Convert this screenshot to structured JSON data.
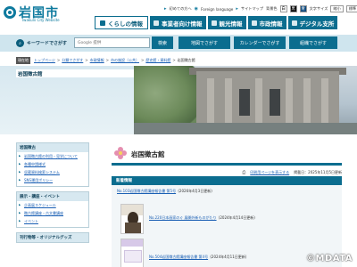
{
  "header": {
    "logo_text": "岩国市",
    "logo_sub": "Iwakuni City Website",
    "utility": {
      "first_visit": "初めての方へ",
      "foreign_language": "Foreign language",
      "sitemap": "サイトマップ",
      "bg_color_label": "背景色",
      "bg_white": "白",
      "bg_black": "黒",
      "bg_blue": "青",
      "font_size_label": "文字サイズ",
      "size_small": "縮小",
      "size_default": "標準",
      "size_large": "拡大"
    },
    "gnav": [
      {
        "label": "くらしの情報"
      },
      {
        "label": "事業者向け情報"
      },
      {
        "label": "観光情報"
      },
      {
        "label": "市政情報"
      },
      {
        "label": "デジタル支所"
      }
    ]
  },
  "search": {
    "label": "キーワードでさがす",
    "placeholder": "Google 提供",
    "submit_label": "検索",
    "buttons": [
      {
        "label": "地図でさがす"
      },
      {
        "label": "カレンダーでさがす"
      },
      {
        "label": "組織でさがす"
      }
    ]
  },
  "breadcrumb": {
    "here_label": "現在地",
    "items": [
      "トップページ",
      "分類でさがす",
      "市政情報",
      "市の施設（公共）",
      "歴史館・資料館"
    ],
    "current": "岩国徴古館"
  },
  "hero": {
    "title": "岩国徴古館"
  },
  "sidebar": {
    "sections": [
      {
        "title": "岩国徴古",
        "items": [
          "岩国徴古館の利用・見学について",
          "各種申請様式",
          "収蔵資料検索システム",
          "SNS運用ポリシー"
        ]
      },
      {
        "title": "展示・講座・イベント",
        "items": [
          "企画展スケジュール",
          "徴古館講座・古文書講座",
          "イベント"
        ]
      },
      {
        "title": "刊行物等・オリジナルグッズ",
        "items": []
      }
    ]
  },
  "main": {
    "title": "岩国徴古館",
    "print_label": "印刷用ページを表示する",
    "updated": "掲載日：2025年11月5日更新",
    "news_head": "新着情報",
    "news": [
      {
        "title": "No.103岩国徴古館講座報告書 第5号",
        "date": "(2026年4月3日更新)"
      },
      {
        "title": "No.220日本画家のぐ 展開外新ものがたり",
        "date": "(2024年4月14日更新)"
      },
      {
        "title": "No.504岩国徴古館講座報告書 第4号",
        "date": "(2024年4月11日更新)"
      }
    ]
  },
  "watermark": "©MDATA",
  "colors": {
    "brand": "#0b6d8f",
    "link": "#1a5fb4",
    "search_bg": "#cfe5ee"
  }
}
